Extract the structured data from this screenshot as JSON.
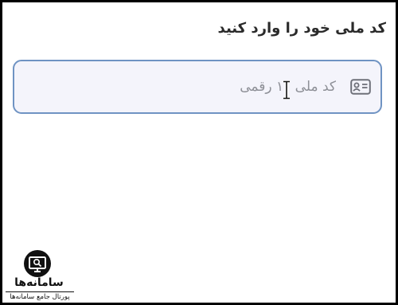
{
  "page": {
    "title": "کد ملی خود را وارد کنید"
  },
  "national_id_input": {
    "placeholder": "کد ملی ۱۰ رقمی",
    "icon": "id-card-icon",
    "border_color": "#6f93c3",
    "background_color": "#f4f4fb"
  },
  "cursor": {
    "icon": "text-cursor-icon"
  },
  "watermark": {
    "brand": "سامانه‌ها",
    "tagline": "پورتال جامع سامانه‌ها",
    "icon": "monitor-search-icon"
  }
}
